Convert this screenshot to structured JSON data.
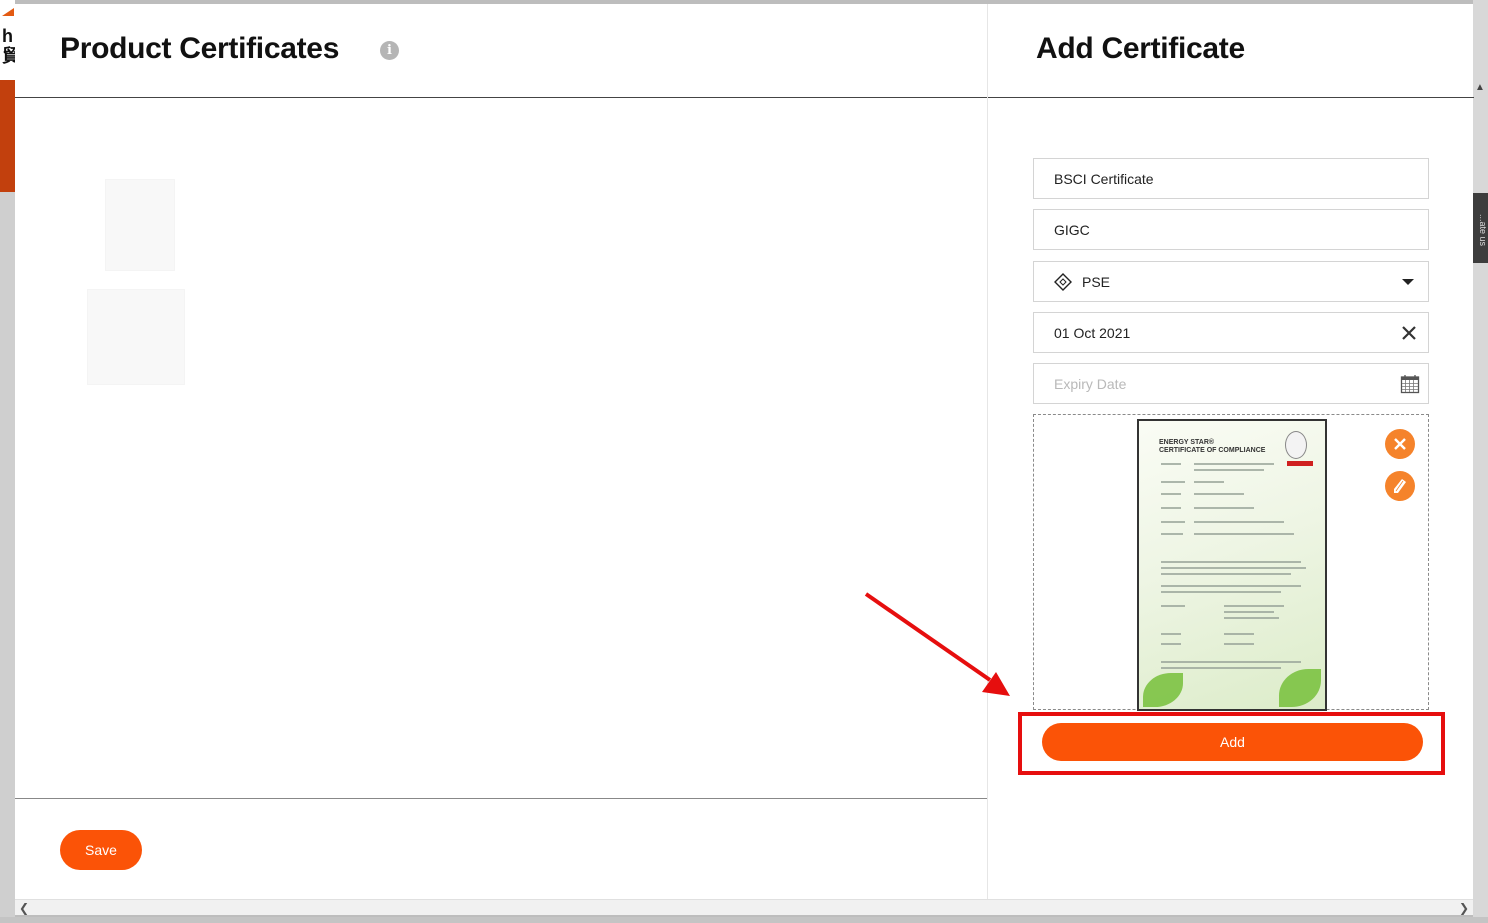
{
  "background": {
    "logo_text": "h\n貿",
    "side_tab_text": "...ate us"
  },
  "left_panel": {
    "title": "Product Certificates",
    "info_icon_glyph": "i",
    "save_label": "Save"
  },
  "right_panel": {
    "title": "Add Certificate",
    "fields": {
      "certificate_name": "BSCI Certificate",
      "issuer": "GIGC",
      "certificate_type": "PSE",
      "issue_date": "01 Oct 2021",
      "expiry_date_placeholder": "Expiry Date"
    },
    "uploaded_image": {
      "header_line1": "ENERGY STAR®",
      "header_line2": "CERTIFICATE OF COMPLIANCE"
    },
    "add_label": "Add"
  },
  "colors": {
    "accent": "#fb5307",
    "icon_orange": "#f5832b",
    "annotation_red": "#e60e0e"
  },
  "icons": {
    "remove": "close-icon",
    "edit": "pencil-icon",
    "clear": "close-icon",
    "dropdown": "chevron-down-icon",
    "calendar": "calendar-icon",
    "type_tag": "tag-icon",
    "info": "info-icon"
  }
}
